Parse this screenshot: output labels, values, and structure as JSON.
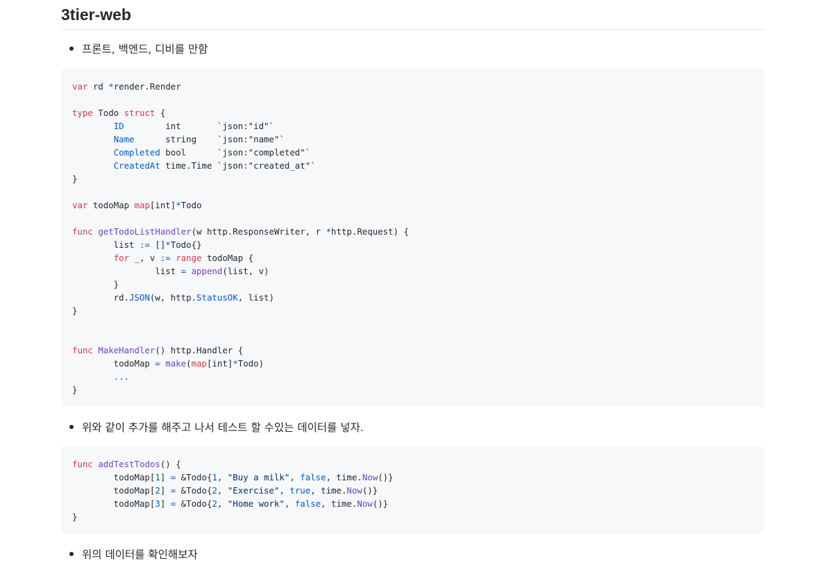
{
  "heading": "3tier-web",
  "bullets": [
    "프론트, 백엔드, 디비를 만함",
    "위와 같이 추가를 해주고 나서 테스트 할 수있는 데이터를 넣자.",
    "위의 데이터를 확인해보자"
  ],
  "code_blocks": [
    {
      "lines": [
        "var rd *render.Render",
        "",
        "type Todo struct {",
        "        ID        int       `json:\"id\"`",
        "        Name      string    `json:\"name\"`",
        "        Completed bool      `json:\"completed\"`",
        "        CreatedAt time.Time `json:\"created_at\"`",
        "}",
        "",
        "var todoMap map[int]*Todo",
        "",
        "func getTodoListHandler(w http.ResponseWriter, r *http.Request) {",
        "        list := []*Todo{}",
        "        for _, v := range todoMap {",
        "                list = append(list, v)",
        "        }",
        "        rd.JSON(w, http.StatusOK, list)",
        "}",
        "",
        "",
        "func MakeHandler() http.Handler {",
        "        todoMap = make(map[int]*Todo)",
        "        ...",
        "}"
      ]
    },
    {
      "lines": [
        "func addTestTodos() {",
        "        todoMap[1] = &Todo{1, \"Buy a milk\", false, time.Now()}",
        "        todoMap[2] = &Todo{2, \"Exercise\", true, time.Now()}",
        "        todoMap[3] = &Todo{2, \"Home work\", false, time.Now()}",
        "}"
      ]
    }
  ]
}
